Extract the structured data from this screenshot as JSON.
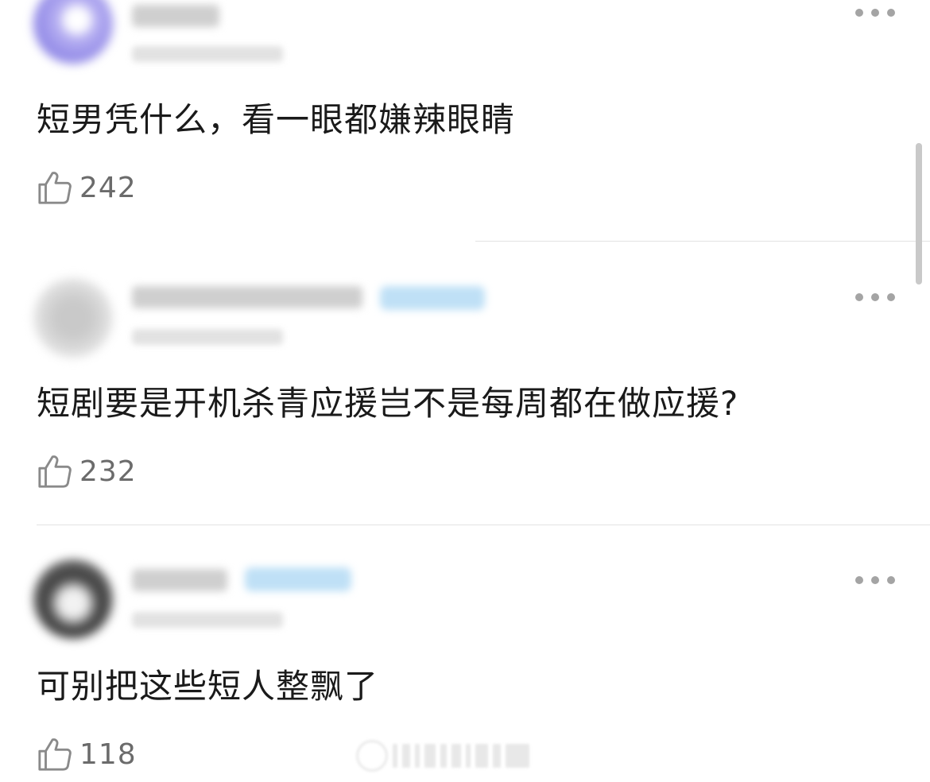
{
  "comments": [
    {
      "text": "短男凭什么，看一眼都嫌辣眼睛",
      "likes": "242",
      "avatar": "blurred-avatar",
      "has_badge": false
    },
    {
      "text": "短剧要是开机杀青应援岂不是每周都在做应援?",
      "likes": "232",
      "avatar": "blurred-avatar",
      "has_badge": true
    },
    {
      "text": "可别把这些短人整飘了",
      "likes": "118",
      "avatar": "blurred-avatar",
      "has_badge": true
    }
  ],
  "icons": {
    "like": "thumbs-up-icon",
    "more": "more-dots-icon"
  },
  "colors": {
    "text": "#1a1a1a",
    "like_count": "#6b6b6b",
    "icon": "#8a8a8a",
    "divider": "#e3e3e3",
    "badge_blur": "#bfe0f6"
  }
}
